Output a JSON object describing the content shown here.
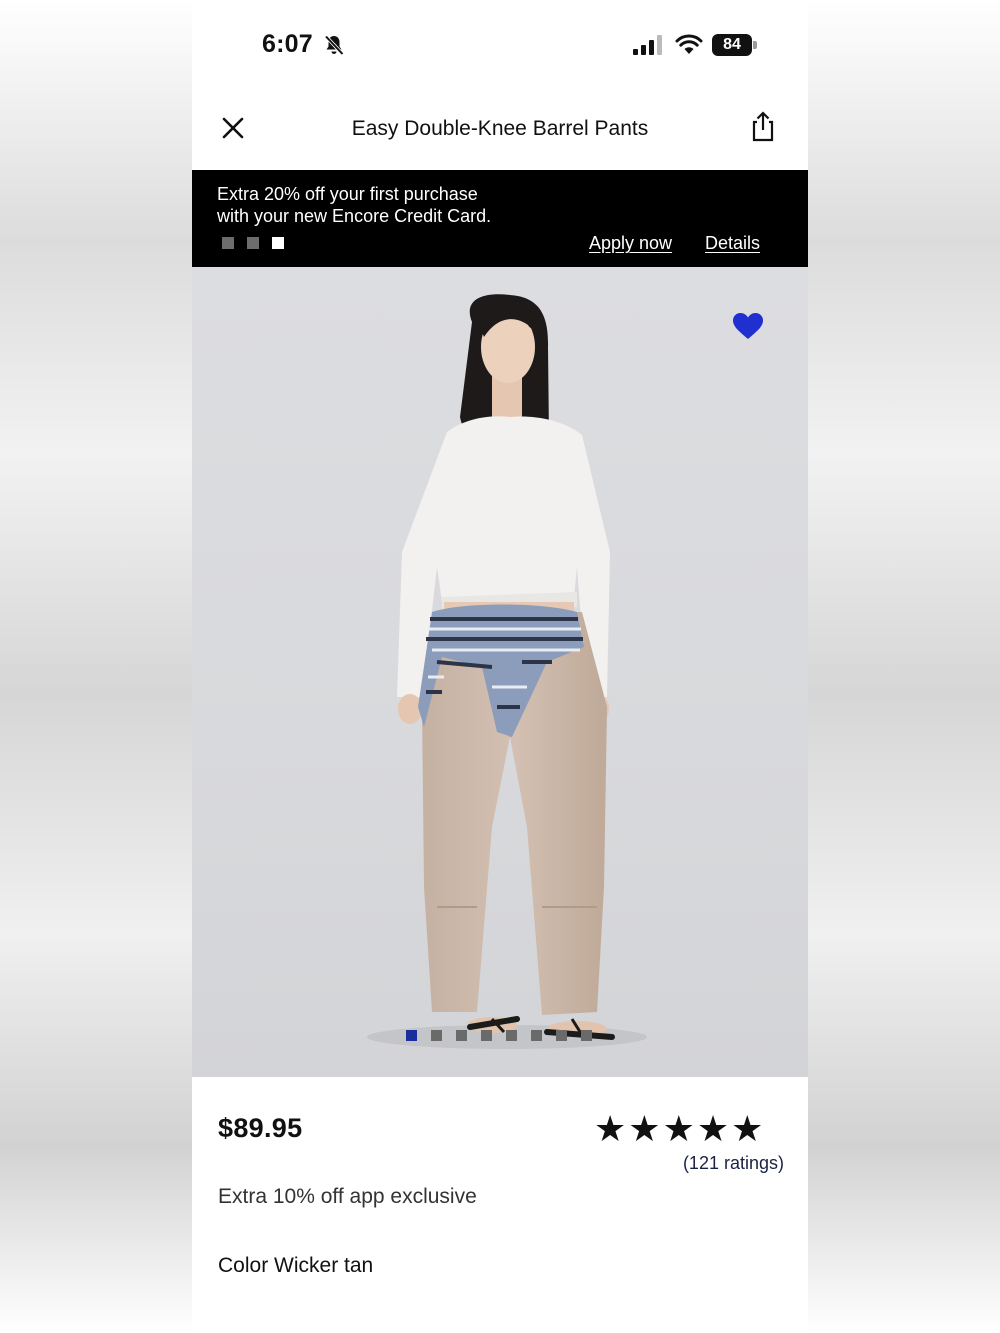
{
  "status_bar": {
    "time": "6:07",
    "battery": "84"
  },
  "header": {
    "title": "Easy Double-Knee Barrel Pants"
  },
  "promo": {
    "line1": "Extra 20% off your first purchase",
    "line2": "with your new Encore Credit Card.",
    "apply_label": "Apply now",
    "details_label": "Details",
    "slides": 3,
    "active_slide": 3
  },
  "gallery": {
    "images": 8,
    "active_index": 1,
    "favorite_color": "#1f2fd0"
  },
  "product": {
    "price": "$89.95",
    "rating_stars": 5,
    "ratings_text": "(121 ratings)",
    "offer": "Extra 10% off app exclusive",
    "color_label": "Color",
    "color_value": "Wicker tan"
  },
  "icons": [
    "bell-slash-icon",
    "signal-icon",
    "wifi-icon",
    "battery-icon",
    "close-icon",
    "share-icon",
    "heart-icon",
    "star-icon"
  ]
}
